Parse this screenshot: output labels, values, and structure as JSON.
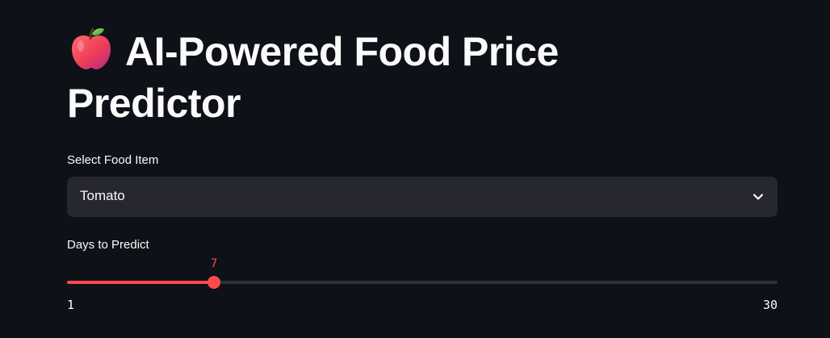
{
  "page": {
    "title": "AI-Powered Food Price Predictor",
    "title_icon": "red-apple-icon"
  },
  "food_select": {
    "label": "Select Food Item",
    "value": "Tomato",
    "icon": "chevron-down-icon"
  },
  "days_slider": {
    "label": "Days to Predict",
    "value": 7,
    "min": 1,
    "max": 30,
    "min_label": "1",
    "max_label": "30",
    "value_label": "7",
    "accent_color": "#ff4b4b"
  },
  "colors": {
    "background": "#0e1117",
    "input_background": "#262730",
    "track": "#2d2f38",
    "text": "#fafafa"
  }
}
